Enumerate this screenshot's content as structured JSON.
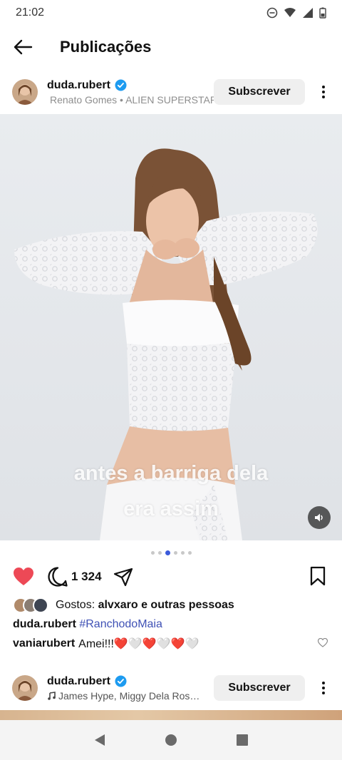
{
  "status_bar": {
    "time": "21:02"
  },
  "header": {
    "title": "Publicações"
  },
  "post": {
    "username": "duda.rubert",
    "submeta": "Renato Gomes • ALIEN SUPERSTAR",
    "subscribe_label": "Subscrever",
    "overlay_text_line1": "antes a barriga dela",
    "overlay_text_line2": "era assim",
    "comment_count": "1 324",
    "likes_prefix": "Gostos: ",
    "likes_user": "alvxaro",
    "likes_suffix": " e outras pessoas",
    "caption_user": "duda.rubert",
    "caption_hashtag": "#RanchodoMaia",
    "comment_user": "vaniarubert",
    "comment_text": "Amei!!!❤️🤍❤️🤍❤️🤍",
    "carousel_active_index": 2,
    "carousel_count": 6
  },
  "next_post": {
    "username": "duda.rubert",
    "submeta": "James Hype, Miggy Dela Ros…",
    "subscribe_label": "Subscrever"
  },
  "colors": {
    "verified": "#1d9bf0",
    "like_red": "#ed4956",
    "hashtag": "#3f51b5",
    "carousel_active": "#3b5bdb"
  }
}
